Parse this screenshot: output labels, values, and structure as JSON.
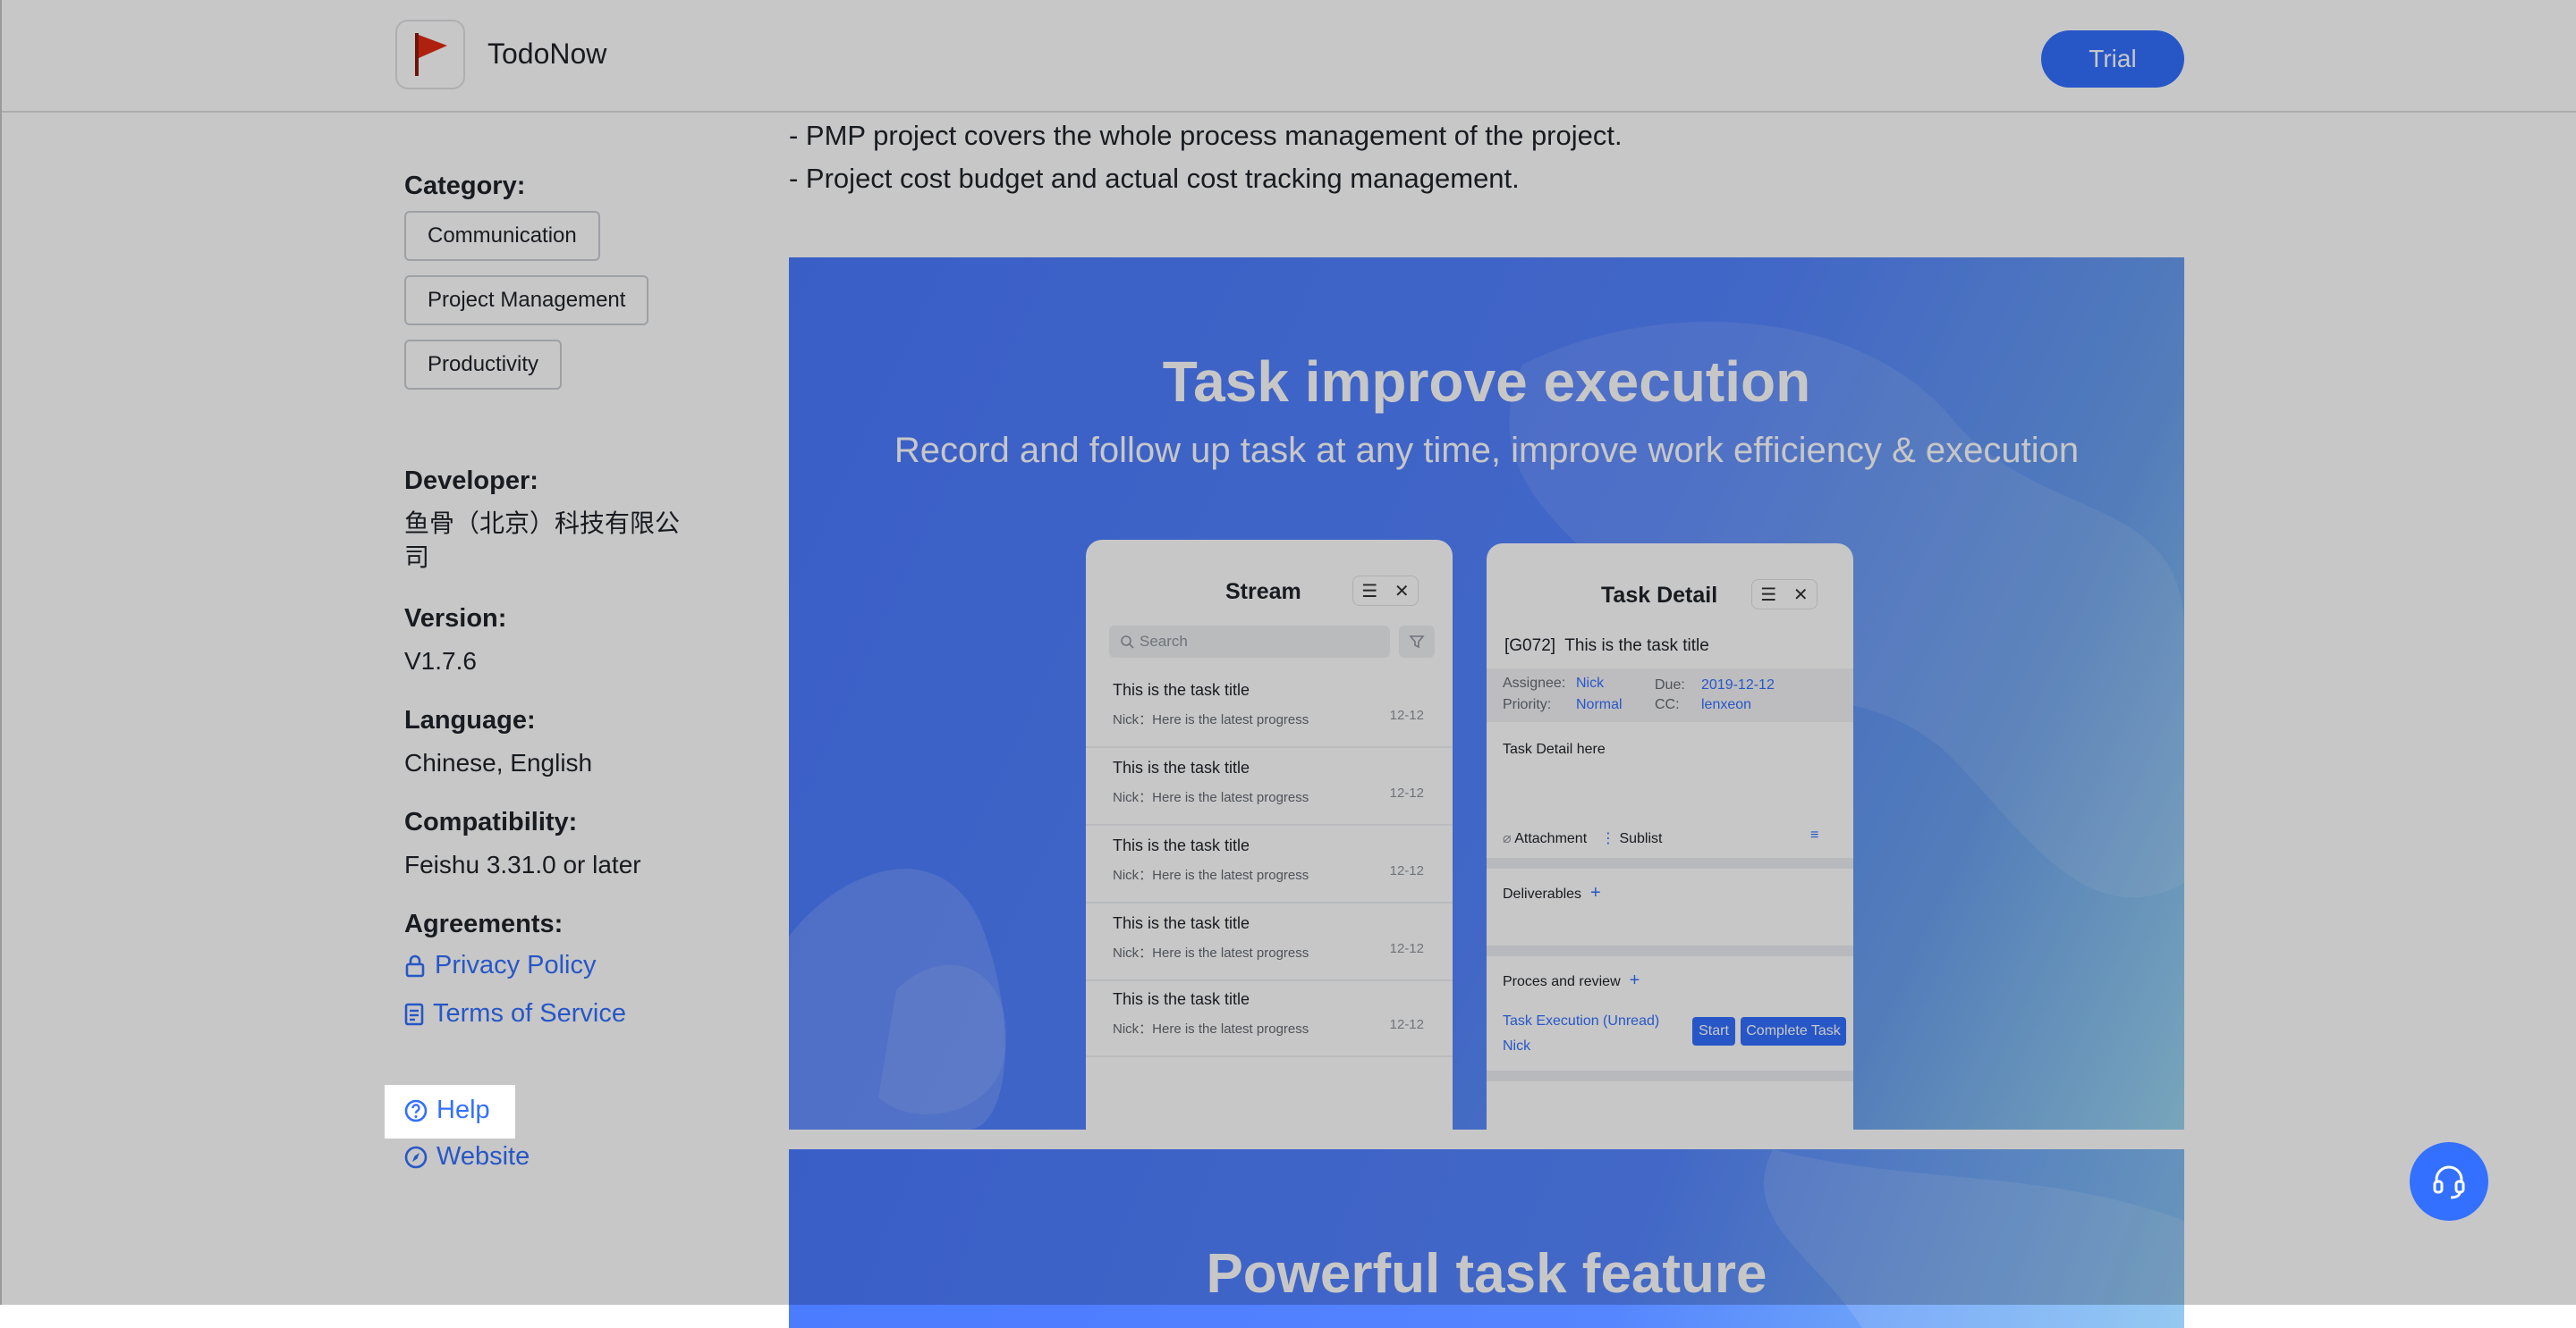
{
  "header": {
    "app_name": "TodoNow",
    "trial_label": "Trial"
  },
  "description": {
    "lines": [
      "- PMP project covers the whole process management of the project.",
      "- Project cost budget and actual cost tracking management."
    ]
  },
  "sidebar": {
    "category_label": "Category:",
    "categories": [
      "Communication",
      "Project Management",
      "Productivity"
    ],
    "developer_label": "Developer:",
    "developer_line1": "鱼骨（北京）科技有限公",
    "developer_line2": "司",
    "version_label": "Version:",
    "version": "V1.7.6",
    "language_label": "Language:",
    "language": "Chinese, English",
    "compatibility_label": "Compatibility:",
    "compatibility": "Feishu 3.31.0 or later",
    "agreements_label": "Agreements:",
    "privacy_policy": "Privacy Policy",
    "terms_of_service": "Terms of Service",
    "help": "Help",
    "website": "Website"
  },
  "banner": {
    "title": "Task improve execution",
    "subtitle": "Record and follow up task at any time, improve work efficiency & execution",
    "stream": {
      "title": "Stream",
      "search_placeholder": "Search",
      "items": [
        {
          "title": "This is the task title",
          "sub": "Nick：Here is the latest progress",
          "date": "12-12"
        },
        {
          "title": "This is the task title",
          "sub": "Nick：Here is the latest progress",
          "date": "12-12"
        },
        {
          "title": "This is the task title",
          "sub": "Nick：Here is the latest progress",
          "date": "12-12"
        },
        {
          "title": "This is the task title",
          "sub": "Nick：Here is the latest progress",
          "date": "12-12"
        },
        {
          "title": "This is the task title",
          "sub": "Nick：Here is the latest progress",
          "date": "12-12"
        }
      ]
    },
    "detail": {
      "title": "Task Detail",
      "task_id": "[G072]",
      "task_title": "This is the task title",
      "assignee_label": "Assignee:",
      "assignee": "Nick",
      "due_label": "Due:",
      "due": "2019-12-12",
      "priority_label": "Priority:",
      "priority": "Normal",
      "cc_label": "CC:",
      "cc": "lenxeon",
      "body": "Task Detail here",
      "attachment": "Attachment",
      "sublist": "Sublist",
      "deliverables": "Deliverables",
      "process_review": "Proces and review",
      "execution_status": "Task Execution (Unread)",
      "execution_user": "Nick",
      "start_label": "Start",
      "complete_label": "Complete Task"
    }
  },
  "banner2": {
    "title": "Powerful task feature"
  },
  "colors": {
    "accent": "#3370ff",
    "overlay": "rgba(0,0,0,0.22)"
  }
}
